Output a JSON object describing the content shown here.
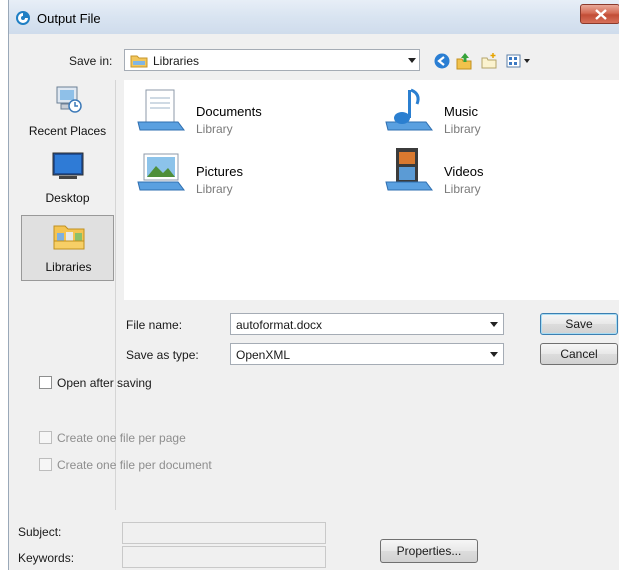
{
  "window": {
    "title": "Output File"
  },
  "toolbar": {
    "save_in_label": "Save in:",
    "save_in_value": "Libraries",
    "icons": [
      "back-icon",
      "up-folder-icon",
      "new-folder-icon",
      "views-menu-icon"
    ]
  },
  "places": [
    {
      "label": "Recent Places",
      "icon": "recent-places-icon"
    },
    {
      "label": "Desktop",
      "icon": "desktop-icon"
    },
    {
      "label": "Libraries",
      "icon": "libraries-icon",
      "selected": true
    }
  ],
  "libraries": [
    {
      "name": "Documents",
      "type": "Library",
      "icon": "documents-library-icon"
    },
    {
      "name": "Music",
      "type": "Library",
      "icon": "music-library-icon"
    },
    {
      "name": "Pictures",
      "type": "Library",
      "icon": "pictures-library-icon"
    },
    {
      "name": "Videos",
      "type": "Library",
      "icon": "videos-library-icon"
    }
  ],
  "form": {
    "file_name_label": "File name:",
    "file_name_value": "autoformat.docx",
    "save_as_type_label": "Save as type:",
    "save_as_type_value": "OpenXML",
    "save_button": "Save",
    "cancel_button": "Cancel"
  },
  "options": {
    "open_after_saving": "Open after saving",
    "one_file_per_page": "Create one file per page",
    "one_file_per_document": "Create one file per document"
  },
  "metadata": {
    "subject_label": "Subject:",
    "keywords_label": "Keywords:",
    "properties_button": "Properties..."
  },
  "colors": {
    "close_button": "#c24d36",
    "titlebar": "#d9e4f1",
    "selected_place": "#e0e0e0"
  }
}
